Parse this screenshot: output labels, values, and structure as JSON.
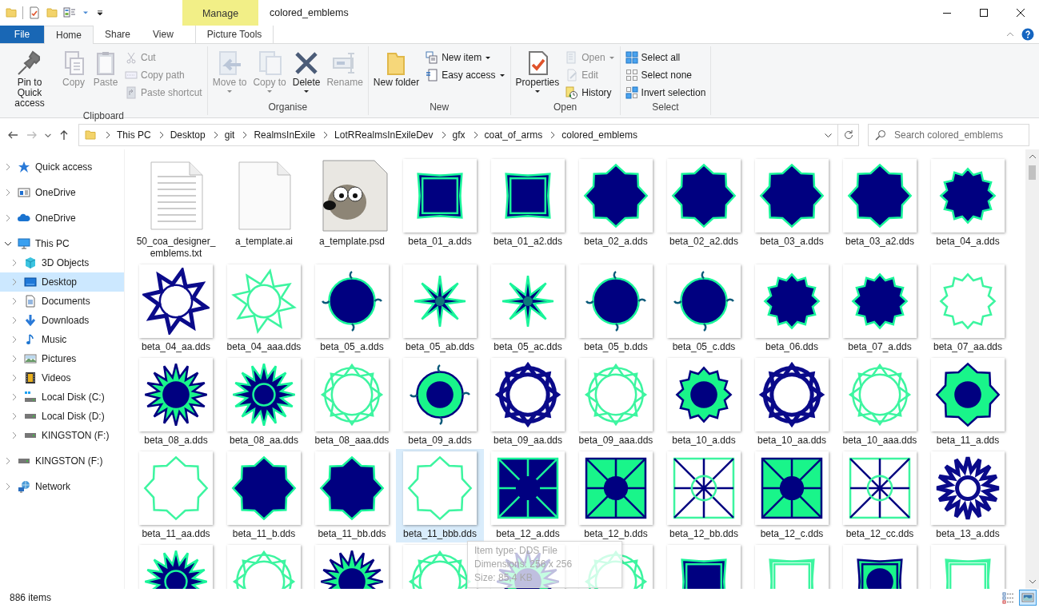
{
  "window": {
    "title": "colored_emblems",
    "contextual_tab": "Manage"
  },
  "tabs": [
    {
      "label": "File",
      "kind": "file",
      "selected": false
    },
    {
      "label": "Home",
      "kind": "tab",
      "selected": true
    },
    {
      "label": "Share",
      "kind": "tab",
      "selected": false
    },
    {
      "label": "View",
      "kind": "tab",
      "selected": false
    },
    {
      "label": "Picture Tools",
      "kind": "context",
      "selected": false
    }
  ],
  "ribbon": [
    {
      "name": "Clipboard",
      "items": [
        {
          "kind": "large",
          "label": "Pin to Quick access",
          "disabled": false,
          "dropdown": false
        },
        {
          "kind": "large",
          "label": "Copy",
          "disabled": true,
          "dropdown": false
        },
        {
          "kind": "large",
          "label": "Paste",
          "disabled": true,
          "dropdown": false
        },
        {
          "kind": "small",
          "label": "Cut",
          "disabled": true,
          "dropdown": false
        },
        {
          "kind": "small",
          "label": "Copy path",
          "disabled": true,
          "dropdown": false
        },
        {
          "kind": "small",
          "label": "Paste shortcut",
          "disabled": true,
          "dropdown": false
        }
      ]
    },
    {
      "name": "Organise",
      "items": [
        {
          "kind": "large",
          "label": "Move to",
          "disabled": true,
          "dropdown": true
        },
        {
          "kind": "large",
          "label": "Copy to",
          "disabled": true,
          "dropdown": true
        },
        {
          "kind": "large",
          "label": "Delete",
          "disabled": false,
          "dropdown": true
        },
        {
          "kind": "large",
          "label": "Rename",
          "disabled": true,
          "dropdown": false
        }
      ]
    },
    {
      "name": "New",
      "items": [
        {
          "kind": "large",
          "label": "New folder",
          "disabled": false,
          "dropdown": false
        },
        {
          "kind": "small",
          "label": "New item",
          "disabled": false,
          "dropdown": true
        },
        {
          "kind": "small",
          "label": "Easy access",
          "disabled": false,
          "dropdown": true
        }
      ]
    },
    {
      "name": "Open",
      "items": [
        {
          "kind": "large",
          "label": "Properties",
          "disabled": false,
          "dropdown": true
        },
        {
          "kind": "small",
          "label": "Open",
          "disabled": true,
          "dropdown": true
        },
        {
          "kind": "small",
          "label": "Edit",
          "disabled": true,
          "dropdown": false
        },
        {
          "kind": "small",
          "label": "History",
          "disabled": false,
          "dropdown": false
        }
      ]
    },
    {
      "name": "Select",
      "items": [
        {
          "kind": "small",
          "label": "Select all",
          "disabled": false,
          "dropdown": false
        },
        {
          "kind": "small",
          "label": "Select none",
          "disabled": false,
          "dropdown": false
        },
        {
          "kind": "small",
          "label": "Invert selection",
          "disabled": false,
          "dropdown": false
        }
      ]
    }
  ],
  "address": {
    "crumbs": [
      "This PC",
      "Desktop",
      "git",
      "RealmsInExile",
      "LotRRealmsInExileDev",
      "gfx",
      "coat_of_arms",
      "colored_emblems"
    ]
  },
  "search": {
    "placeholder": "Search colored_emblems"
  },
  "sidebar": {
    "items": [
      {
        "label": "Quick access",
        "expanded": false,
        "selected": false
      },
      {
        "label": "OneDrive",
        "expanded": false,
        "selected": false
      },
      {
        "label": "OneDrive",
        "expanded": false,
        "selected": false
      },
      {
        "label": "This PC",
        "expanded": true,
        "selected": false,
        "children": [
          {
            "label": "3D Objects",
            "expanded": false,
            "selected": false
          },
          {
            "label": "Desktop",
            "expanded": false,
            "selected": true
          },
          {
            "label": "Documents",
            "expanded": false,
            "selected": false
          },
          {
            "label": "Downloads",
            "expanded": false,
            "selected": false
          },
          {
            "label": "Music",
            "expanded": false,
            "selected": false
          },
          {
            "label": "Pictures",
            "expanded": false,
            "selected": false
          },
          {
            "label": "Videos",
            "expanded": false,
            "selected": false
          },
          {
            "label": "Local Disk (C:)",
            "expanded": false,
            "selected": false
          },
          {
            "label": "Local Disk (D:)",
            "expanded": false,
            "selected": false
          },
          {
            "label": "KINGSTON (F:)",
            "expanded": false,
            "selected": false
          }
        ]
      },
      {
        "label": "KINGSTON (F:)",
        "expanded": false,
        "selected": false
      },
      {
        "label": "Network",
        "expanded": false,
        "selected": false
      }
    ]
  },
  "files": [
    {
      "name": "50_coa_designer_ emblems.txt",
      "kind": "text",
      "selected": false
    },
    {
      "name": "a_template.ai",
      "kind": "blank",
      "selected": false
    },
    {
      "name": "a_template.psd",
      "kind": "image",
      "selected": false
    },
    {
      "name": "beta_01_a.dds",
      "kind": "emblem",
      "selected": false
    },
    {
      "name": "beta_01_a2.dds",
      "kind": "emblem",
      "selected": false
    },
    {
      "name": "beta_02_a.dds",
      "kind": "emblem",
      "selected": false
    },
    {
      "name": "beta_02_a2.dds",
      "kind": "emblem",
      "selected": false
    },
    {
      "name": "beta_03_a.dds",
      "kind": "emblem",
      "selected": false
    },
    {
      "name": "beta_03_a2.dds",
      "kind": "emblem",
      "selected": false
    },
    {
      "name": "beta_04_a.dds",
      "kind": "emblem",
      "selected": false
    },
    {
      "name": "beta_04_aa.dds",
      "kind": "emblem",
      "selected": false
    },
    {
      "name": "beta_04_aaa.dds",
      "kind": "emblem",
      "selected": false
    },
    {
      "name": "beta_05_a.dds",
      "kind": "emblem",
      "selected": false
    },
    {
      "name": "beta_05_ab.dds",
      "kind": "emblem",
      "selected": false
    },
    {
      "name": "beta_05_ac.dds",
      "kind": "emblem",
      "selected": false
    },
    {
      "name": "beta_05_b.dds",
      "kind": "emblem",
      "selected": false
    },
    {
      "name": "beta_05_c.dds",
      "kind": "emblem",
      "selected": false
    },
    {
      "name": "beta_06.dds",
      "kind": "emblem",
      "selected": false
    },
    {
      "name": "beta_07_a.dds",
      "kind": "emblem",
      "selected": false
    },
    {
      "name": "beta_07_aa.dds",
      "kind": "emblem",
      "selected": false
    },
    {
      "name": "beta_08_a.dds",
      "kind": "emblem",
      "selected": false
    },
    {
      "name": "beta_08_aa.dds",
      "kind": "emblem",
      "selected": false
    },
    {
      "name": "beta_08_aaa.dds",
      "kind": "emblem",
      "selected": false
    },
    {
      "name": "beta_09_a.dds",
      "kind": "emblem",
      "selected": false
    },
    {
      "name": "beta_09_aa.dds",
      "kind": "emblem",
      "selected": false
    },
    {
      "name": "beta_09_aaa.dds",
      "kind": "emblem",
      "selected": false
    },
    {
      "name": "beta_10_a.dds",
      "kind": "emblem",
      "selected": false
    },
    {
      "name": "beta_10_aa.dds",
      "kind": "emblem",
      "selected": false
    },
    {
      "name": "beta_10_aaa.dds",
      "kind": "emblem",
      "selected": false
    },
    {
      "name": "beta_11_a.dds",
      "kind": "emblem",
      "selected": false
    },
    {
      "name": "beta_11_aa.dds",
      "kind": "emblem",
      "selected": false
    },
    {
      "name": "beta_11_b.dds",
      "kind": "emblem",
      "selected": false
    },
    {
      "name": "beta_11_bb.dds",
      "kind": "emblem",
      "selected": false
    },
    {
      "name": "beta_11_bbb.dds",
      "kind": "emblem",
      "selected": true
    },
    {
      "name": "beta_12_a.dds",
      "kind": "emblem",
      "selected": false
    },
    {
      "name": "beta_12_b.dds",
      "kind": "emblem",
      "selected": false
    },
    {
      "name": "beta_12_bb.dds",
      "kind": "emblem",
      "selected": false
    },
    {
      "name": "beta_12_c.dds",
      "kind": "emblem",
      "selected": false
    },
    {
      "name": "beta_12_cc.dds",
      "kind": "emblem",
      "selected": false
    },
    {
      "name": "beta_13_a.dds",
      "kind": "emblem",
      "selected": false
    },
    {
      "kind": "emblem",
      "selected": false
    },
    {
      "kind": "emblem",
      "selected": false
    },
    {
      "kind": "emblem",
      "selected": false
    },
    {
      "kind": "emblem",
      "selected": false
    },
    {
      "kind": "emblem",
      "selected": false
    },
    {
      "kind": "emblem",
      "selected": false
    },
    {
      "kind": "emblem",
      "selected": false
    },
    {
      "kind": "emblem",
      "selected": false
    },
    {
      "kind": "emblem",
      "selected": false
    },
    {
      "kind": "emblem",
      "selected": false
    }
  ],
  "tooltip": {
    "lines": [
      "Item type: DDS File",
      "Dimensions: 256 x 256",
      "Size: 85,4 KB"
    ]
  },
  "status_bar": {
    "count": "886 items",
    "views": [
      {
        "kind": "details",
        "selected": false
      },
      {
        "kind": "large-icons",
        "selected": true
      }
    ]
  }
}
